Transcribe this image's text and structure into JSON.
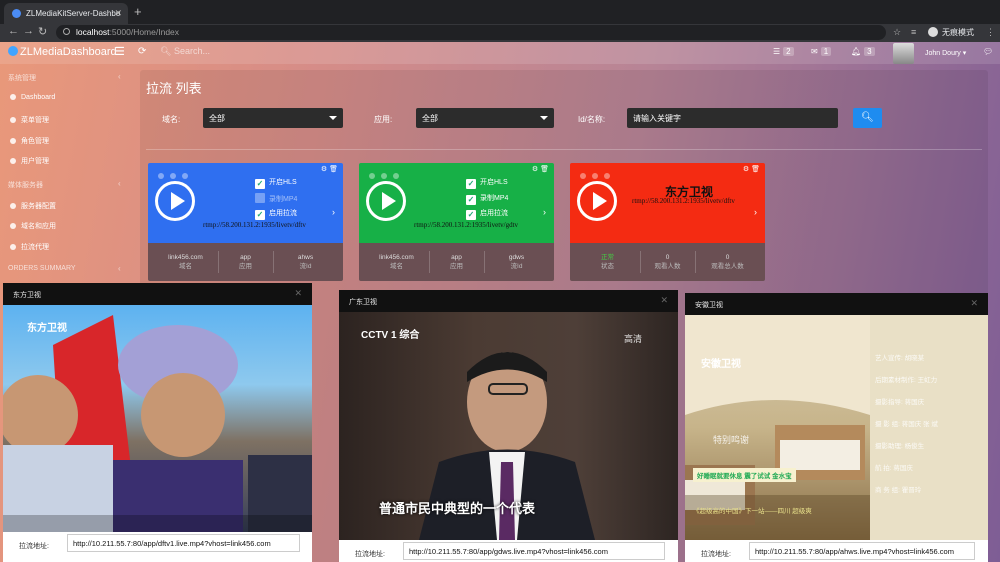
{
  "browser": {
    "tab_title": "ZLMediaKitServer-Dashbo",
    "url_host": "localhost",
    "url_path": ":5000/Home/Index",
    "incognito_label": "无痕模式"
  },
  "header": {
    "brand": "ZLMediaDashboard",
    "search_placeholder": "Search...",
    "badge_list": "2",
    "badge_mail": "1",
    "badge_bell": "3",
    "user_name": "John Doury",
    "accent": "#1e8cf0"
  },
  "sidebar": {
    "section1": "系统管理",
    "items1": [
      "Dashboard",
      "菜单管理",
      "角色管理",
      "用户管理"
    ],
    "section2": "媒体服务器",
    "items2": [
      "服务器配置",
      "域名和应用",
      "拉流代理"
    ],
    "section3": "ORDERS SUMMARY"
  },
  "page": {
    "title": "拉流 列表",
    "filter_domain_label": "域名:",
    "filter_domain_value": "全部",
    "filter_app_label": "应用:",
    "filter_app_value": "全部",
    "filter_id_label": "Id/名称:",
    "filter_id_placeholder": "请输入关键字",
    "search_icon": "search-icon"
  },
  "cards": [
    {
      "color": "#2f6ff0",
      "hls": "开启HLS",
      "mp4": "录制MP4",
      "pull": "启用拉流",
      "rtmp": "rtmp://58.200.131.2:1935/livetv/dftv",
      "c1v": "link456.com",
      "c1k": "域名",
      "c2v": "app",
      "c2k": "应用",
      "c3v": "ahws",
      "c3k": "流Id"
    },
    {
      "color": "#17b047",
      "hls": "开启HLS",
      "mp4": "录制MP4",
      "pull": "启用拉流",
      "rtmp": "rtmp://58.200.131.2:1935/livetv/gdtv",
      "c1v": "link456.com",
      "c1k": "域名",
      "c2v": "app",
      "c2k": "应用",
      "c3v": "gdws",
      "c3k": "流Id"
    },
    {
      "color": "#f42b12",
      "title": "东方卫视",
      "rtmp": "rtmp://58.200.131.2:1935/livetv/dftv",
      "c1v": "正常",
      "c1k": "状态",
      "c2v": "0",
      "c2k": "观看人数",
      "c3v": "0",
      "c3k": "观看总人数"
    }
  ],
  "modals": [
    {
      "title": "东方卫视",
      "url_label": "拉流地址:",
      "url": "http://10.211.55.7:80/app/dftv1.live.mp4?vhost=link456.com",
      "logo": "东方卫视"
    },
    {
      "title": "广东卫视",
      "url_label": "拉流地址:",
      "url": "http://10.211.55.7:80/app/gdws.live.mp4?vhost=link456.com",
      "logo": "CCTV 1 综合",
      "corner": "高清",
      "subtitle": "普通市民中典型的一个代表"
    },
    {
      "title": "安徽卫视",
      "url_label": "拉流地址:",
      "url": "http://10.211.55.7:80/app/ahws.live.mp4?vhost=link456.com",
      "logo": "安徽卫视",
      "credits": [
        "艺人宣传: 胡晓某",
        "后期素材制作: 王虹力",
        "摄影指导: 蒋国庆",
        "摄 影 组: 蒋国庆 张 斌",
        "摄影助理: 杨俊生",
        "航 拍: 蒋国庆",
        "商 务 组: 瞿晋玲"
      ],
      "thanks": "特别鸣谢",
      "sponsor": "好睡眠就要休息 震了试试 金水宝",
      "banner": "《超级高的中国》下一站——四川 超级爽"
    }
  ]
}
